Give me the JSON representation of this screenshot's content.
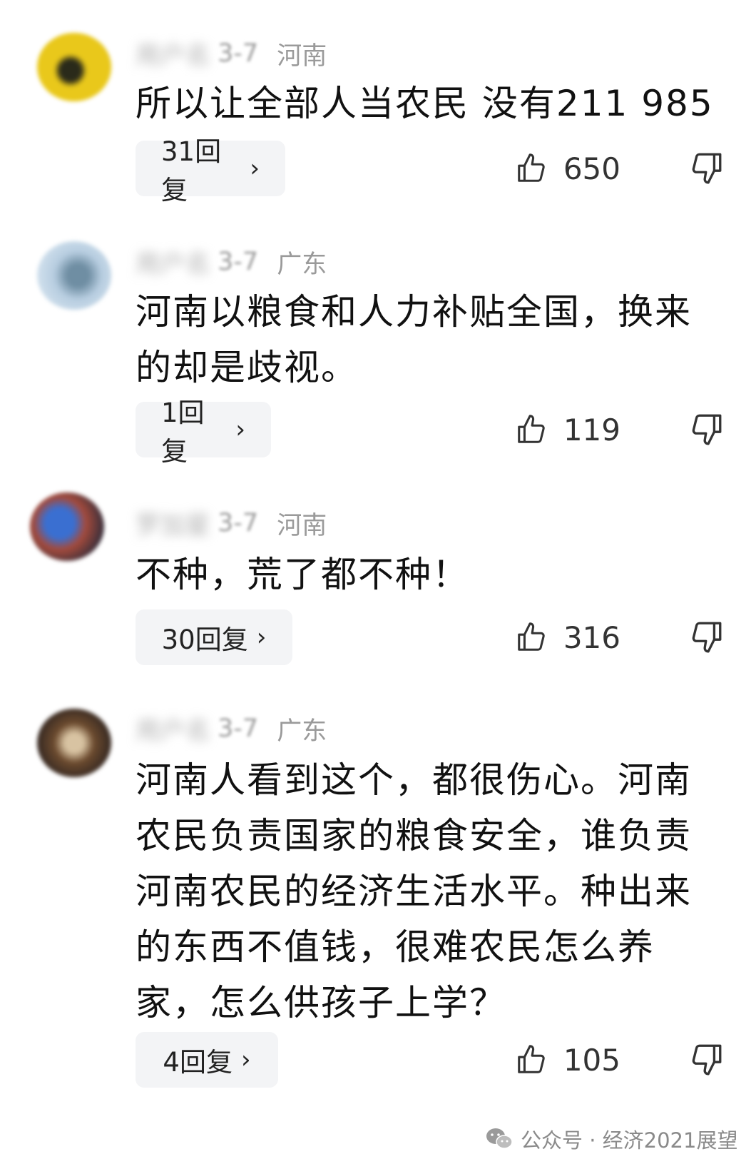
{
  "comments": [
    {
      "username": "用户名",
      "date": "3-7",
      "region": "河南",
      "text": "所以让全部人当农民 没有211 985",
      "replies": "31回复",
      "likes": "650"
    },
    {
      "username": "用户名",
      "date": "3-7",
      "region": "广东",
      "text": "河南以粮食和人力补贴全国，换来的却是歧视。",
      "replies": "1回复",
      "likes": "119"
    },
    {
      "username": "罗加星",
      "date": "3-7",
      "region": "河南",
      "text": "不种，荒了都不种！",
      "replies": "30回复",
      "likes": "316"
    },
    {
      "username": "用户名",
      "date": "3-7",
      "region": "广东",
      "text": "河南人看到这个，都很伤心。河南农民负责国家的粮食安全，谁负责河南农民的经济生活水平。种出来的东西不值钱，很难农民怎么养家，怎么供孩子上学？",
      "replies": "4回复",
      "likes": "105"
    }
  ],
  "reply_chevron": "›",
  "icons": {
    "like": "thumbs-up-icon",
    "dislike": "thumbs-down-icon",
    "watermark": "wechat-icon"
  },
  "watermark": {
    "label": "公众号 · 经济2021展望"
  },
  "colors": {
    "background": "#ffffff",
    "text": "#111111",
    "meta": "#9a9a9a",
    "reply_bg": "#f3f4f6"
  }
}
